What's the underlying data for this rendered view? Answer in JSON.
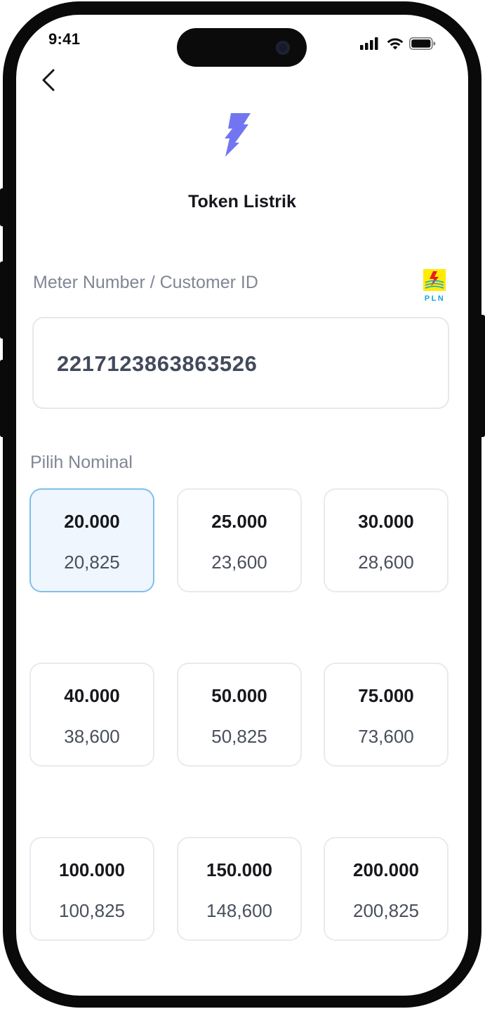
{
  "status_bar": {
    "time": "9:41"
  },
  "header": {
    "title": "Token Listrik"
  },
  "meter": {
    "label": "Meter Number / Customer ID",
    "value": "2217123863863526",
    "provider_logo_text": "PLN"
  },
  "nominal": {
    "label": "Pilih Nominal",
    "selected_index": 0,
    "options": [
      {
        "amount": "20.000",
        "price": "20,825"
      },
      {
        "amount": "25.000",
        "price": "23,600"
      },
      {
        "amount": "30.000",
        "price": "28,600"
      },
      {
        "amount": "40.000",
        "price": "38,600"
      },
      {
        "amount": "50.000",
        "price": "50,825"
      },
      {
        "amount": "75.000",
        "price": "73,600"
      },
      {
        "amount": "100.000",
        "price": "100,825"
      },
      {
        "amount": "150.000",
        "price": "148,600"
      },
      {
        "amount": "200.000",
        "price": "200,825"
      }
    ]
  },
  "icons": {
    "back": "chevron-left-icon",
    "header": "lightning-bolt-icon",
    "signal": "cellular-signal-icon",
    "wifi": "wifi-icon",
    "battery": "battery-icon"
  },
  "colors": {
    "accent": "#7176f0",
    "selected_border": "#7ec0e9",
    "selected_bg": "#eff6fd",
    "pln_yellow": "#ffeb00",
    "pln_blue": "#12a5e0",
    "pln_red": "#e31e24"
  }
}
